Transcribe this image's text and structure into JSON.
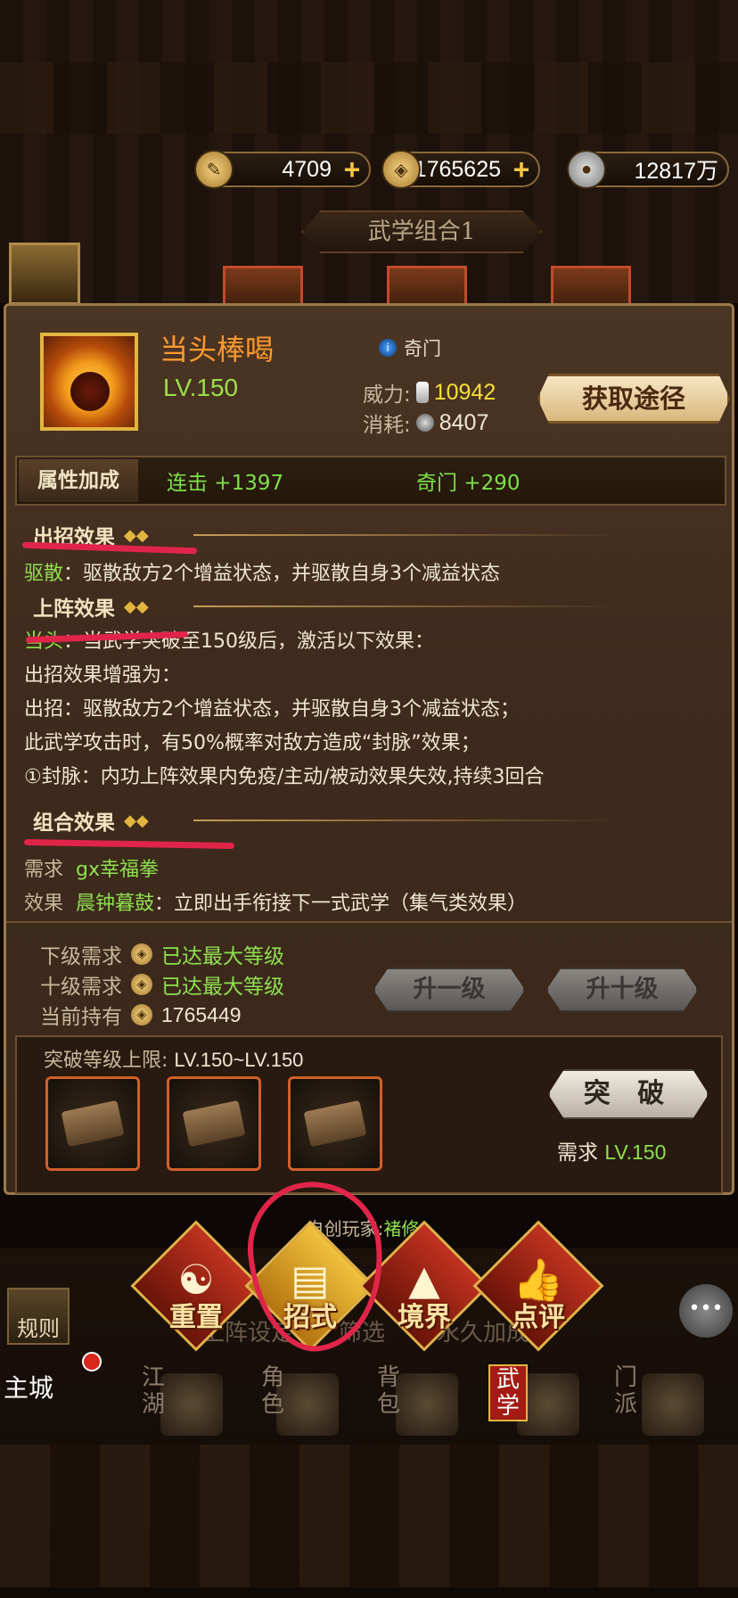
{
  "currency": [
    {
      "icon": "scroll-icon",
      "value": "4709"
    },
    {
      "icon": "tael-icon",
      "value": "1765625"
    },
    {
      "icon": "silver-coin-icon",
      "value": "12817万"
    }
  ],
  "combo_title": "武学组合1",
  "skill": {
    "name": "当头棒喝",
    "level": "LV.150",
    "school": "奇门",
    "power_label": "威力:",
    "power_value": "10942",
    "cost_label": "消耗:",
    "cost_value": "8407",
    "get_button": "获取途径"
  },
  "attributes": {
    "label": "属性加成",
    "items": [
      "连击 +1397",
      "奇门 +290"
    ]
  },
  "sections": {
    "attack": {
      "title": "出招效果",
      "name": "驱散",
      "text": "：驱散敌方2个增益状态，并驱散自身3个减益状态"
    },
    "deploy": {
      "title": "上阵效果",
      "name": "当头",
      "text": "：当武学突破至150级后，激活以下效果：",
      "lines": [
        "出招效果增强为：",
        "出招：驱散敌方2个增益状态，并驱散自身3个减益状态；",
        "此武学攻击时，有50%概率对敌方造成“封脉”效果；",
        "①封脉：内功上阵效果内免疫/主动/被动效果失效,持续3回合"
      ]
    },
    "combo": {
      "title": "组合效果",
      "req_label": "需求",
      "req_value": "gx幸福拳",
      "effect_label": "效果",
      "effect_name": "晨钟暮鼓",
      "effect_text": "：立即出手衔接下一式武学（集气类效果）"
    }
  },
  "requirements": {
    "next_label": "下级需求",
    "next_value": "已达最大等级",
    "ten_label": "十级需求",
    "ten_value": "已达最大等级",
    "hold_label": "当前持有",
    "hold_value": "1765449",
    "up1": "升一级",
    "up10": "升十级"
  },
  "breakthrough": {
    "title": "突破等级上限:",
    "range": "LV.150~LV.150",
    "button": "突 破",
    "req_label": "需求",
    "req_value": "LV.150"
  },
  "creator": {
    "label": "自创玩家:",
    "name": "褚修"
  },
  "actions": [
    "重置",
    "招式",
    "境界",
    "点评"
  ],
  "under_labels": [
    "上阵设定",
    "筛选",
    "永久加成"
  ],
  "bottom_nav": [
    "江湖",
    "角色",
    "背包",
    "武学",
    "门派"
  ],
  "rules": "规则",
  "main_city": "主城",
  "colors": {
    "accent": "#ff9a2e",
    "green": "#8fe050",
    "annotation": "#e1254a"
  }
}
